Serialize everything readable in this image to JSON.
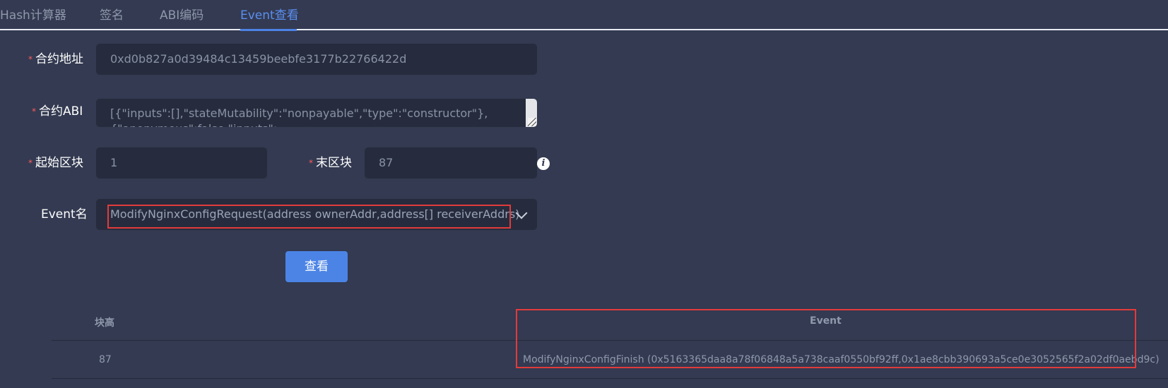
{
  "tabs": [
    {
      "label": "Hash计算器"
    },
    {
      "label": "签名"
    },
    {
      "label": "ABI编码"
    },
    {
      "label": "Event查看"
    }
  ],
  "form": {
    "contract_address": {
      "label": "合约地址",
      "value": "0xd0b827a0d39484c13459beebfe3177b22766422d"
    },
    "contract_abi": {
      "label": "合约ABI",
      "value_line1": "[{\"inputs\":[],\"stateMutability\":\"nonpayable\",\"type\":\"constructor\"},",
      "value_line2": "{\"anonymous\":false,\"inputs\":"
    },
    "start_block": {
      "label": "起始区块",
      "value": "1"
    },
    "end_block": {
      "label": "末区块",
      "value": "87"
    },
    "event_name": {
      "label": "Event名",
      "value": "ModifyNginxConfigRequest(address ownerAddr,address[] receiverAddrs)"
    },
    "required_mark": "*",
    "info_icon": "i",
    "view_button": "查看"
  },
  "table": {
    "columns": [
      "块高",
      "Event"
    ],
    "rows": [
      {
        "height": "87",
        "event": "ModifyNginxConfigFinish (0x5163365daa8a78f06848a5a738caaf0550bf92ff,0x1ae8cbb390693a5ce0e3052565f2a02df0aebd9c)"
      }
    ]
  },
  "colors": {
    "background": "#333a51",
    "input_bg": "#262c3d",
    "accent": "#4c84e6",
    "highlight": "#e23b3b"
  }
}
